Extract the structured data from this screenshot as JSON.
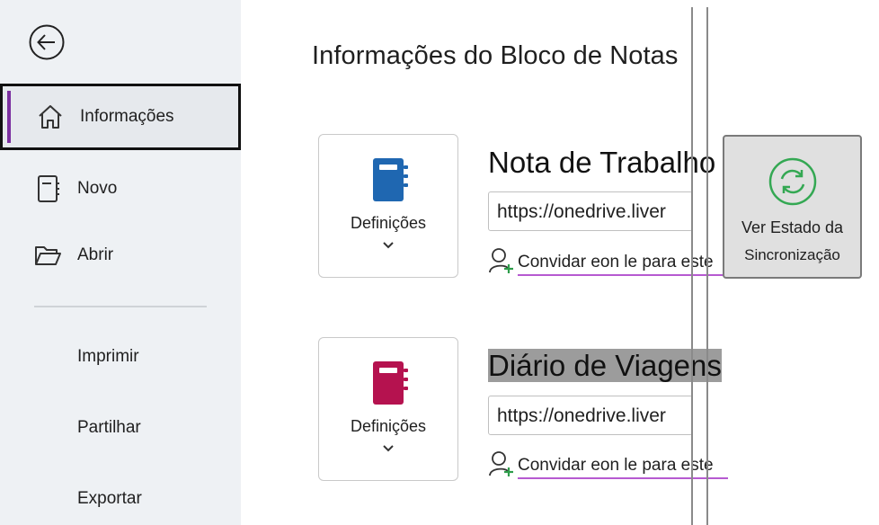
{
  "sidebar": {
    "back_icon": "back-arrow-icon",
    "items": [
      {
        "label": "Informações",
        "icon": "home-icon",
        "active": true
      },
      {
        "label": "Novo",
        "icon": "new-notebook-icon"
      },
      {
        "label": "Abrir",
        "icon": "folder-open-icon"
      }
    ],
    "plain_items": [
      "Imprimir",
      "Partilhar",
      "Exportar"
    ]
  },
  "main": {
    "title": "Informações do Bloco de Notas",
    "notebooks": [
      {
        "name": "Nota de Trabalho",
        "url": "https://onedrive.liver",
        "settings_label": "Definições",
        "invite_text": "Convidar eon le para este",
        "color": "#1f67b1"
      },
      {
        "name": "Diário de Viagens",
        "url": "https://onedrive.liver",
        "settings_label": "Definições",
        "invite_text": "Convidar eon le para este",
        "color": "#b5124f"
      }
    ]
  },
  "sync_panel": {
    "line1": "Ver Estado da",
    "line2": "Sincronização",
    "icon": "sync-icon",
    "icon_color": "#34a853"
  },
  "colors": {
    "accent": "#7b2fa0",
    "sidebar_bg": "#eef1f4"
  }
}
